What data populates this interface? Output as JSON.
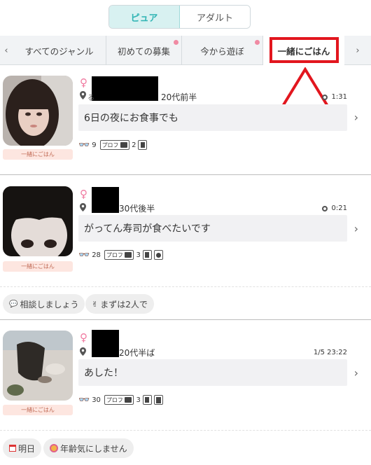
{
  "toggle": {
    "pure_label": "ピュア",
    "adult_label": "アダルト"
  },
  "tabs": [
    {
      "label": "すべてのジャンル",
      "has_dot": false,
      "selected": false
    },
    {
      "label": "初めての募集",
      "has_dot": true,
      "selected": false
    },
    {
      "label": "今から遊ぼ",
      "has_dot": true,
      "selected": false
    },
    {
      "label": "一緒にごはん",
      "has_dot": false,
      "selected": true
    }
  ],
  "arrows": {
    "left": "‹",
    "right": "›"
  },
  "colors": {
    "accent": "#2fb4b4",
    "highlight": "#e2161e",
    "female": "#f07aa0",
    "tag_bg": "#fde6e0"
  },
  "cards": [
    {
      "genre": "一緒にごはん",
      "location_prefix": "る",
      "age": "20代前半",
      "time": "1:31",
      "message": "6日の夜にお食事でも",
      "views": "9",
      "prof_label": "プロフ",
      "photos": "2",
      "icons": [
        "glasses-icon",
        "camera-icon",
        "document-icon"
      ]
    },
    {
      "genre": "一緒にごはん",
      "location_prefix": "",
      "age": "30代後半",
      "time": "0:21",
      "message": "がってん寿司が食べたいです",
      "views": "28",
      "prof_label": "プロフ",
      "photos": "3",
      "icons": [
        "glasses-icon",
        "camera-icon",
        "document-icon",
        "chat-icon"
      ],
      "chips": [
        "相談しましょう",
        "まずは2人で"
      ]
    },
    {
      "genre": "一緒にごはん",
      "location_prefix": "",
      "age": "20代半ば",
      "time": "1/5 23:22",
      "message": "あした！",
      "views": "30",
      "prof_label": "プロフ",
      "photos": "3",
      "icons": [
        "glasses-icon",
        "camera-icon",
        "document-icon",
        "calculator-icon"
      ],
      "chips": [
        "明日",
        "年齢気にしません"
      ]
    }
  ],
  "female_symbol": "♀",
  "chevron": "›"
}
